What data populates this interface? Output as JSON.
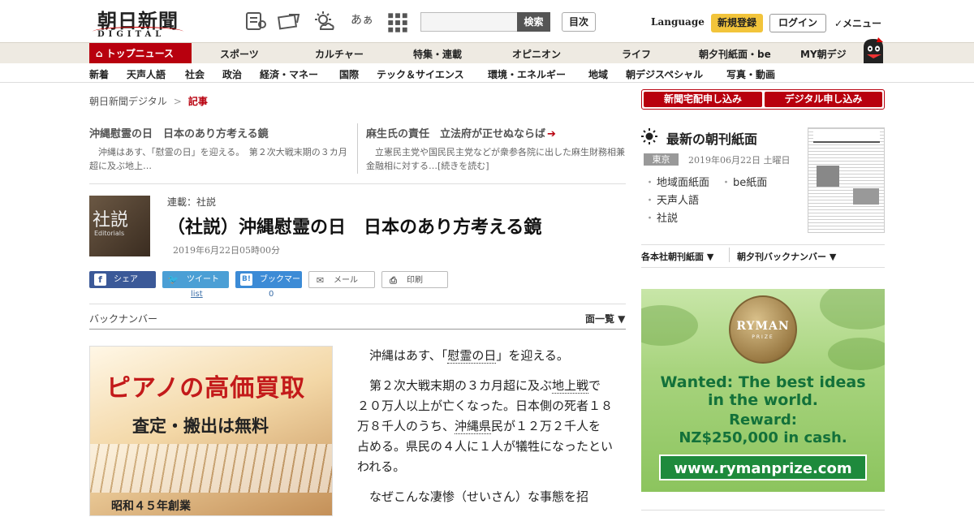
{
  "header": {
    "logo_title": "朝日新聞",
    "logo_sub": "DIGITAL",
    "font_toggle": "あぁ",
    "search_button": "検索",
    "mokuji": "目次",
    "language": "Language",
    "register": "新規登録",
    "login": "ログイン",
    "menu": "✓メニュー"
  },
  "nav_primary": {
    "top_news": "トップニュース",
    "items": [
      "スポーツ",
      "カルチャー",
      "特集・連載",
      "オピニオン",
      "ライフ",
      "朝夕刊紙面・be",
      "MY朝デジ"
    ]
  },
  "nav_secondary": {
    "items": [
      "新着",
      "天声人語",
      "社会",
      "政治",
      "経済・マネー",
      "国際",
      "テック＆サイエンス",
      "環境・エネルギー",
      "地域",
      "朝デジスペシャル",
      "写真・動画"
    ]
  },
  "breadcrumb": {
    "root": "朝日新聞デジタル",
    "sep": ">",
    "current": "記事"
  },
  "related": [
    {
      "headline": "沖縄慰霊の日　日本のあり方考える鏡",
      "summary": "沖縄はあす、「慰霊の日」を迎える。　第２次大戦末期の３カ月超に及ぶ地上…"
    },
    {
      "headline": "麻生氏の責任　立法府が正せぬならば",
      "summary": "立憲民主党や国民民主党などが衆参各院に出した麻生財務相兼金融相に対する…[続きを読む]"
    }
  ],
  "article": {
    "image_kanji": "社説",
    "image_en": "Editorials",
    "series": "連載：社説",
    "title": "（社説）沖縄慰霊の日　日本のあり方考える鏡",
    "date": "2019年6月22日05時00分"
  },
  "share": {
    "facebook": "シェア",
    "twitter": "ツイート",
    "twitter_count": "list",
    "hatena": "ブックマーク",
    "hatena_count": "0",
    "mail": "メール",
    "print": "印刷"
  },
  "backnumber": {
    "label": "バックナンバー",
    "list": "面一覧 ▼"
  },
  "piano_ad": {
    "title": "ピアノの高価買取",
    "subtitle": "査定・搬出は無料",
    "founded": "昭和４５年創業"
  },
  "body": {
    "p1_pre": "沖縄はあす、「",
    "p1_link": "慰霊の日",
    "p1_post": "」を迎える。",
    "p2_pre": "第２次大戦末期の３カ月超に及ぶ",
    "p2_link1": "地上戦",
    "p2_mid": "で２０万人以上が亡くなった。日本側の死者１８万８千人のうち、",
    "p2_link2": "沖縄県",
    "p2_post": "民が１２万２千人を占める。県民の４人に１人が犠牲になったといわれる。",
    "p3": "なぜこんな凄惨（せいさん）な事態を招"
  },
  "sidebar": {
    "subscribe_home": "新聞宅配申し込み",
    "subscribe_digital": "デジタル申し込み",
    "newest_title": "最新の朝刊紙面",
    "region": "東京",
    "paper_date": "2019年06月22日 土曜日",
    "links": [
      "地域面紙面",
      "be紙面",
      "天声人語",
      "社説"
    ],
    "kakuhon": "各本社朝刊紙面 ▼",
    "choyu": "朝夕刊バックナンバー ▼"
  },
  "ryman_ad": {
    "medal_name": "RYMAN",
    "medal_sub": "PRIZE",
    "line1": "Wanted: The best ideas",
    "line2": "in the world.",
    "line3": "Reward:",
    "line4": "NZ$250,000 in cash.",
    "url": "www.rymanprize.com"
  },
  "colors": {
    "brand_red": "#b8000e",
    "register_yellow": "#f2c43b",
    "ad_green": "#13713a"
  }
}
